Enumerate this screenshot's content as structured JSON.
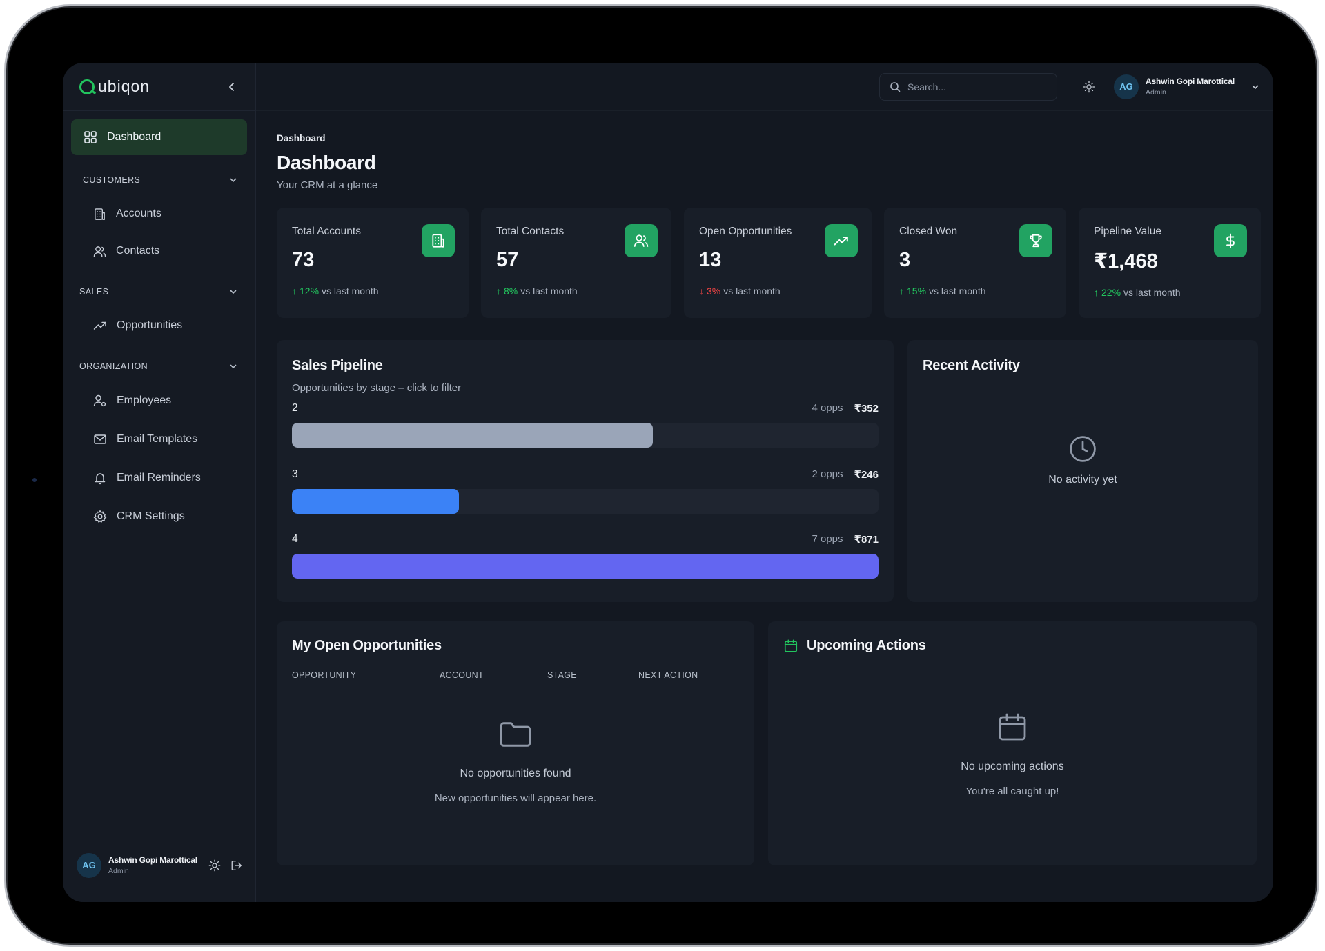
{
  "app": {
    "brand": "Qubiqon"
  },
  "sidebar": {
    "active_item": "Dashboard",
    "sections": [
      {
        "label": "CUSTOMERS",
        "items": [
          "Accounts",
          "Contacts"
        ]
      },
      {
        "label": "SALES",
        "items": [
          "Opportunities"
        ]
      },
      {
        "label": "ORGANIZATION",
        "items": [
          "Employees",
          "Email Templates",
          "Email Reminders",
          "CRM Settings"
        ]
      }
    ],
    "user": {
      "initials": "AG",
      "name": "Ashwin Gopi Marottical",
      "role": "Admin"
    }
  },
  "topbar": {
    "search_placeholder": "Search...",
    "user": {
      "initials": "AG",
      "name": "Ashwin Gopi Marottical",
      "role": "Admin"
    }
  },
  "page": {
    "breadcrumb": "Dashboard",
    "title": "Dashboard",
    "subtitle": "Your CRM at a glance"
  },
  "stats": [
    {
      "label": "Total Accounts",
      "value": "73",
      "trend": "12%",
      "direction": "up",
      "suffix": "vs last month",
      "icon": "building-icon"
    },
    {
      "label": "Total Contacts",
      "value": "57",
      "trend": "8%",
      "direction": "up",
      "suffix": "vs last month",
      "icon": "users-icon"
    },
    {
      "label": "Open Opportunities",
      "value": "13",
      "trend": "3%",
      "direction": "down",
      "suffix": "vs last month",
      "icon": "trending-up-icon"
    },
    {
      "label": "Closed Won",
      "value": "3",
      "trend": "15%",
      "direction": "up",
      "suffix": "vs last month",
      "icon": "trophy-icon"
    },
    {
      "label": "Pipeline Value",
      "value": "₹1,468",
      "trend": "22%",
      "direction": "up",
      "suffix": "vs last month",
      "icon": "dollar-icon"
    }
  ],
  "pipeline": {
    "title": "Sales Pipeline",
    "subtitle": "Opportunities by stage – click to filter",
    "stages": [
      {
        "name": "2",
        "opps": "4 opps",
        "amount": "₹352",
        "fraction": 0.615,
        "color": "#9aa5b8"
      },
      {
        "name": "3",
        "opps": "2 opps",
        "amount": "₹246",
        "fraction": 0.285,
        "color": "#3b82f6"
      },
      {
        "name": "4",
        "opps": "7 opps",
        "amount": "₹871",
        "fraction": 1.0,
        "color": "#6366f1"
      }
    ]
  },
  "activity": {
    "title": "Recent Activity",
    "empty": "No activity yet"
  },
  "opportunities": {
    "title": "My Open Opportunities",
    "columns": [
      "OPPORTUNITY",
      "ACCOUNT",
      "STAGE",
      "NEXT ACTION"
    ],
    "empty_title": "No opportunities found",
    "empty_sub": "New opportunities will appear here."
  },
  "upcoming": {
    "title": "Upcoming Actions",
    "empty_title": "No upcoming actions",
    "empty_sub": "You're all caught up!"
  },
  "colors": {
    "accent_green": "#22c55e",
    "icon_bg": "#22a362",
    "trend_down": "#ef4444"
  }
}
